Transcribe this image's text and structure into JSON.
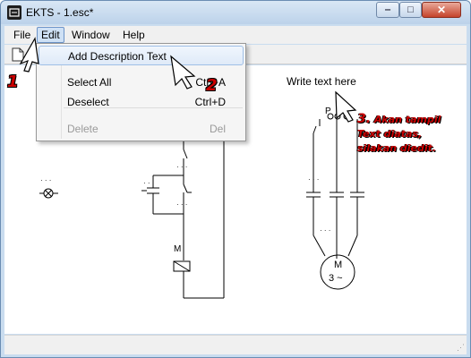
{
  "window": {
    "title": "EKTS - 1.esc*",
    "controls": {
      "minimize": "‒",
      "maximize": "□",
      "close": "✕"
    }
  },
  "menubar": {
    "items": [
      {
        "label": "File"
      },
      {
        "label": "Edit"
      },
      {
        "label": "Window"
      },
      {
        "label": "Help"
      }
    ]
  },
  "edit_menu": {
    "items": [
      {
        "label": "Add Description Text",
        "shortcut": ""
      },
      {
        "label": "Select All",
        "shortcut": "Ctrl+A"
      },
      {
        "label": "Deselect",
        "shortcut": "Ctrl+D"
      },
      {
        "label": "Delete",
        "shortcut": "Del",
        "disabled": true
      }
    ]
  },
  "canvas": {
    "description_text": "Write text here",
    "contactor_label": "M",
    "motor_label_line1": "M",
    "motor_label_line2": "3 ~",
    "terminal_label": "P"
  },
  "annotations": {
    "step1": "1",
    "step2": "2",
    "step3_number": "3.",
    "step3_line1": "Akan tampil",
    "step3_line2": "Text diatas,",
    "step3_line3": "silakan diedit."
  },
  "colors": {
    "annotation": "#cc0000",
    "menu_highlight": "#dfeaf8"
  }
}
